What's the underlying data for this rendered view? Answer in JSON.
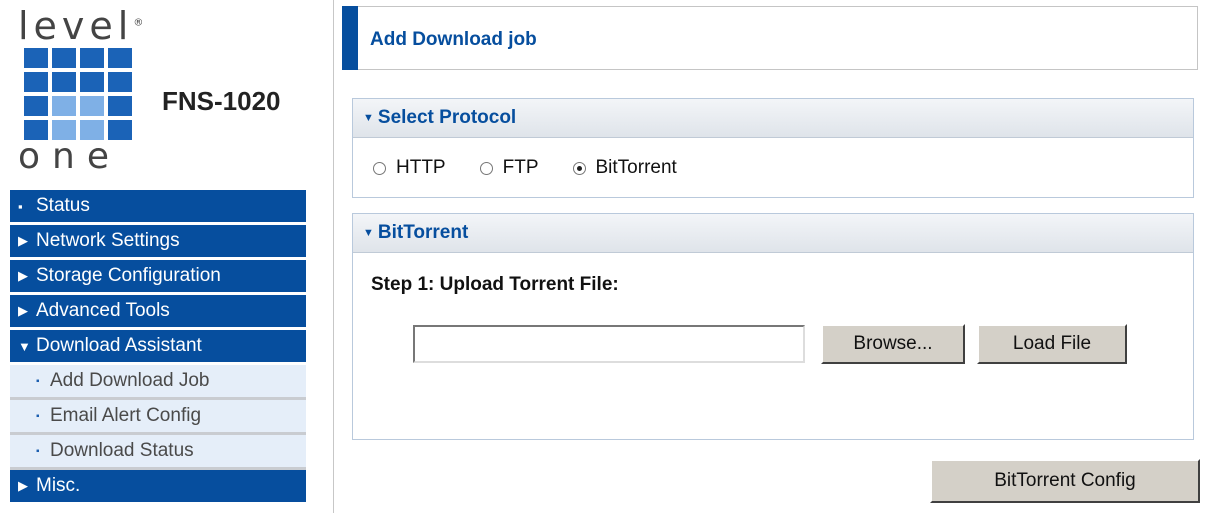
{
  "brand": {
    "logo_top": "level",
    "logo_mark": "®",
    "logo_bottom": "one",
    "product": "FNS-1020"
  },
  "sidebar": {
    "items": [
      {
        "label": "Status",
        "marker": "▪",
        "kind": "main"
      },
      {
        "label": "Network Settings",
        "marker": "▶",
        "kind": "main"
      },
      {
        "label": "Storage Configuration",
        "marker": "▶",
        "kind": "main"
      },
      {
        "label": "Advanced Tools",
        "marker": "▶",
        "kind": "main"
      },
      {
        "label": "Download Assistant",
        "marker": "▼",
        "kind": "main"
      },
      {
        "label": "Add Download Job",
        "marker": "▪",
        "kind": "sub"
      },
      {
        "label": "Email Alert Config",
        "marker": "▪",
        "kind": "sub"
      },
      {
        "label": "Download Status",
        "marker": "▪",
        "kind": "sub"
      },
      {
        "label": "Misc.",
        "marker": "▶",
        "kind": "main"
      }
    ]
  },
  "main": {
    "title": "Add Download job",
    "protocol_section": {
      "title": "Select Protocol",
      "options": [
        {
          "label": "HTTP",
          "selected": false
        },
        {
          "label": "FTP",
          "selected": false
        },
        {
          "label": "BitTorrent",
          "selected": true
        }
      ]
    },
    "bittorrent_section": {
      "title": "BitTorrent",
      "step_label": "Step 1: Upload Torrent File:",
      "file_value": "",
      "browse_label": "Browse...",
      "load_label": "Load File"
    },
    "config_button": "BitTorrent Config"
  },
  "colors": {
    "nav_blue": "#064e9e",
    "sub_bg": "#e5eef9",
    "button_gray": "#d4d0c8"
  }
}
